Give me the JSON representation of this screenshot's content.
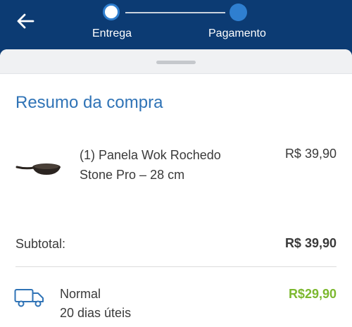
{
  "header": {
    "back_icon": "arrow-left-icon",
    "steps": [
      {
        "label": "Entrega",
        "state": "active"
      },
      {
        "label": "Pagamento",
        "state": "next"
      }
    ]
  },
  "summary": {
    "title": "Resumo da compra",
    "product": {
      "image_icon": "wok-pan-icon",
      "name": "(1) Panela Wok Rochedo Stone Pro – 28 cm",
      "price": "R$ 39,90"
    },
    "subtotal_label": "Subtotal:",
    "subtotal_value": "R$ 39,90",
    "shipping": {
      "icon": "truck-icon",
      "name": "Normal",
      "time": "20 dias úteis",
      "price": "R$29,90"
    }
  },
  "colors": {
    "header_bg": "#0c3b73",
    "accent_blue": "#2f73b6",
    "price_green": "#7cb82f"
  }
}
